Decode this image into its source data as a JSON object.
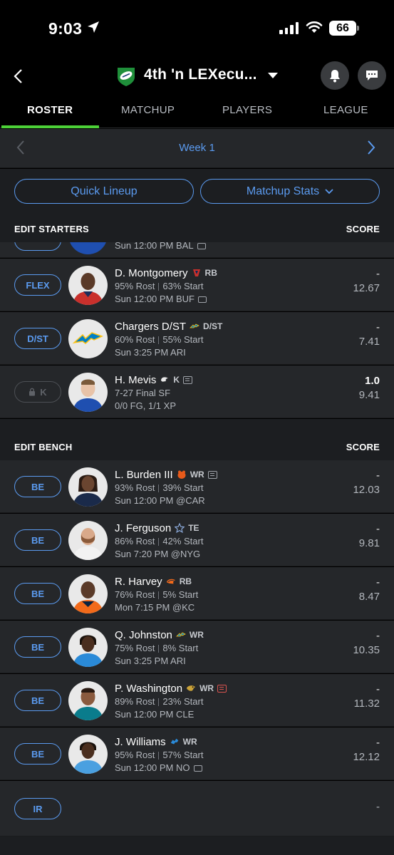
{
  "status": {
    "time": "9:03",
    "battery": "66"
  },
  "header": {
    "team_name": "4th 'n LEXecu..."
  },
  "tabs": [
    {
      "label": "ROSTER"
    },
    {
      "label": "MATCHUP"
    },
    {
      "label": "PLAYERS"
    },
    {
      "label": "LEAGUE"
    }
  ],
  "week": {
    "label": "Week 1"
  },
  "actions": {
    "quick_lineup": "Quick Lineup",
    "matchup_stats": "Matchup Stats"
  },
  "starters": {
    "title": "EDIT STARTERS",
    "score_label": "SCORE",
    "partial": {
      "sub": "Sun 12:00 PM BAL"
    },
    "rows": [
      {
        "slot": "FLEX",
        "name": "D. Montgomery",
        "pos": "RB",
        "rost": "95% Rost",
        "start": "63% Start",
        "game": "Sun 12:00 PM BUF",
        "actual": "-",
        "projected": "12.67"
      },
      {
        "slot": "D/ST",
        "name": "Chargers D/ST",
        "pos": "D/ST",
        "rost": "60% Rost",
        "start": "55% Start",
        "game": "Sun 3:25 PM ARI",
        "actual": "-",
        "projected": "7.41"
      },
      {
        "slot": "K",
        "name": "H. Mevis",
        "pos": "K",
        "line2": "7-27 Final SF",
        "line3": "0/0 FG, 1/1 XP",
        "actual": "1.0",
        "projected": "9.41"
      }
    ]
  },
  "bench": {
    "title": "EDIT BENCH",
    "score_label": "SCORE",
    "rows": [
      {
        "slot": "BE",
        "name": "L. Burden III",
        "pos": "WR",
        "rost": "93% Rost",
        "start": "39% Start",
        "game": "Sun 12:00 PM @CAR",
        "actual": "-",
        "projected": "12.03"
      },
      {
        "slot": "BE",
        "name": "J. Ferguson",
        "pos": "TE",
        "rost": "86% Rost",
        "start": "42% Start",
        "game": "Sun 7:20 PM @NYG",
        "actual": "-",
        "projected": "9.81"
      },
      {
        "slot": "BE",
        "name": "R. Harvey",
        "pos": "RB",
        "rost": "76% Rost",
        "start": "5% Start",
        "game": "Mon 7:15 PM @KC",
        "actual": "-",
        "projected": "8.47"
      },
      {
        "slot": "BE",
        "name": "Q. Johnston",
        "pos": "WR",
        "rost": "75% Rost",
        "start": "8% Start",
        "game": "Sun 3:25 PM ARI",
        "actual": "-",
        "projected": "10.35"
      },
      {
        "slot": "BE",
        "name": "P. Washington",
        "pos": "WR",
        "rost": "89% Rost",
        "start": "23% Start",
        "game": "Sun 12:00 PM CLE",
        "actual": "-",
        "projected": "11.32"
      },
      {
        "slot": "BE",
        "name": "J. Williams",
        "pos": "WR",
        "rost": "95% Rost",
        "start": "57% Start",
        "game": "Sun 12:00 PM NO",
        "actual": "-",
        "projected": "12.12"
      }
    ],
    "ir": {
      "slot": "IR",
      "projected": "-"
    }
  }
}
